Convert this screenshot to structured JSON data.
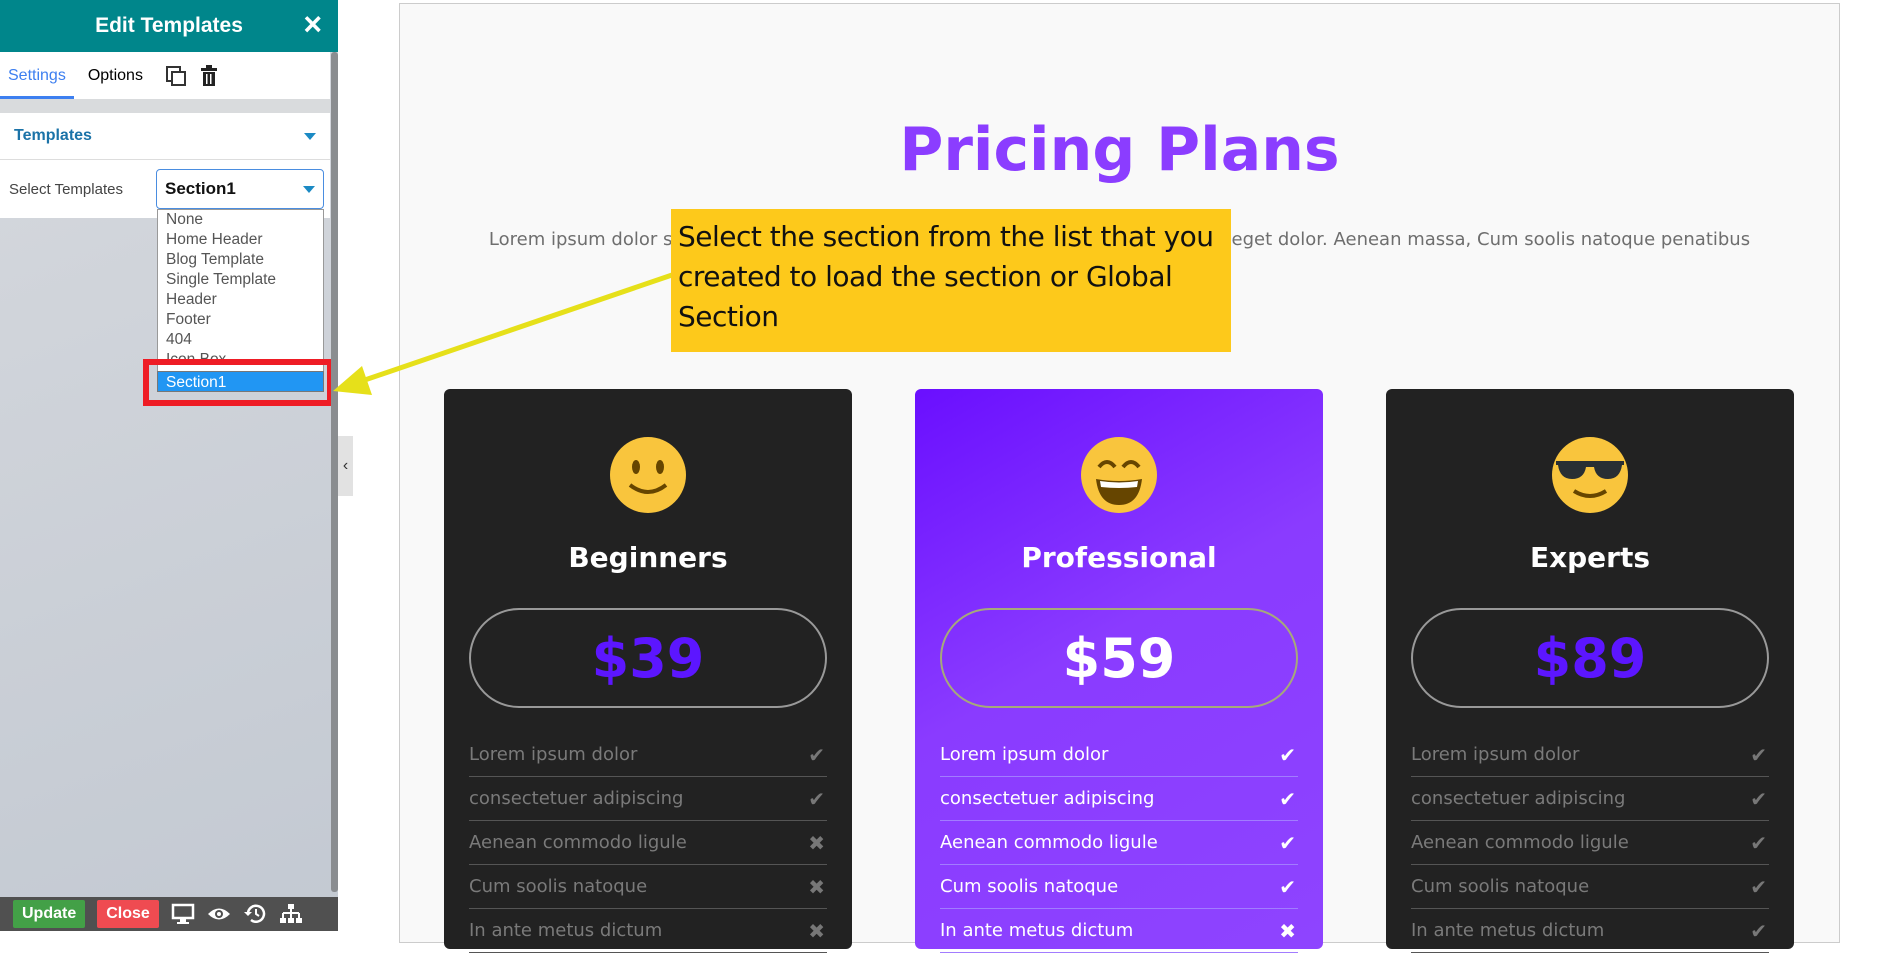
{
  "sidebar": {
    "title": "Edit Templates",
    "close_icon": "×",
    "tabs": [
      {
        "label": "Settings",
        "active": true
      },
      {
        "label": "Options",
        "active": false
      }
    ],
    "section_title": "Templates",
    "select_label": "Select Templates",
    "select_value": "Section1",
    "options": [
      "None",
      "Home Header",
      "Blog Template",
      "Single Template",
      "Header",
      "Footer",
      "404",
      "Icon Box",
      "Section1"
    ],
    "highlighted_option": "Section1",
    "bottom": {
      "update": "Update",
      "close": "Close"
    },
    "collapse": "‹"
  },
  "colors": {
    "teal": "#00868b",
    "purple": "#8b3dff",
    "price": "#5c16ff",
    "callout": "#fdc91b",
    "highlight": "#ee1c25",
    "update": "#43a047",
    "close": "#ef4b51"
  },
  "page": {
    "title": "Pricing Plans",
    "subtitle": "Lorem ipsum dolor sit amet, consectetuer adipiscing elit. Aenean commodo ligula eget dolor. Aenean massa, Cum soolis natoque penatibus"
  },
  "callout": "Select the section from the list that you created to load the section or Global Section",
  "cards": [
    {
      "name": "Beginners",
      "price": "$39",
      "face": "smile",
      "features": [
        {
          "text": "Lorem ipsum dolor",
          "mark": "✔"
        },
        {
          "text": "consectetuer adipiscing",
          "mark": "✔"
        },
        {
          "text": "Aenean commodo ligule",
          "mark": "✖"
        },
        {
          "text": "Cum soolis natoque",
          "mark": "✖"
        },
        {
          "text": "In ante metus dictum",
          "mark": "✖"
        }
      ]
    },
    {
      "name": "Professional",
      "price": "$59",
      "face": "grin",
      "features": [
        {
          "text": "Lorem ipsum dolor",
          "mark": "✔"
        },
        {
          "text": "consectetuer adipiscing",
          "mark": "✔"
        },
        {
          "text": "Aenean commodo ligule",
          "mark": "✔"
        },
        {
          "text": "Cum soolis natoque",
          "mark": "✔"
        },
        {
          "text": "In ante metus dictum",
          "mark": "✖"
        }
      ]
    },
    {
      "name": "Experts",
      "price": "$89",
      "face": "sunglasses",
      "features": [
        {
          "text": "Lorem ipsum dolor",
          "mark": "✔"
        },
        {
          "text": "consectetuer adipiscing",
          "mark": "✔"
        },
        {
          "text": "Aenean commodo ligule",
          "mark": "✔"
        },
        {
          "text": "Cum soolis natoque",
          "mark": "✔"
        },
        {
          "text": "In ante metus dictum",
          "mark": "✔"
        }
      ]
    }
  ]
}
